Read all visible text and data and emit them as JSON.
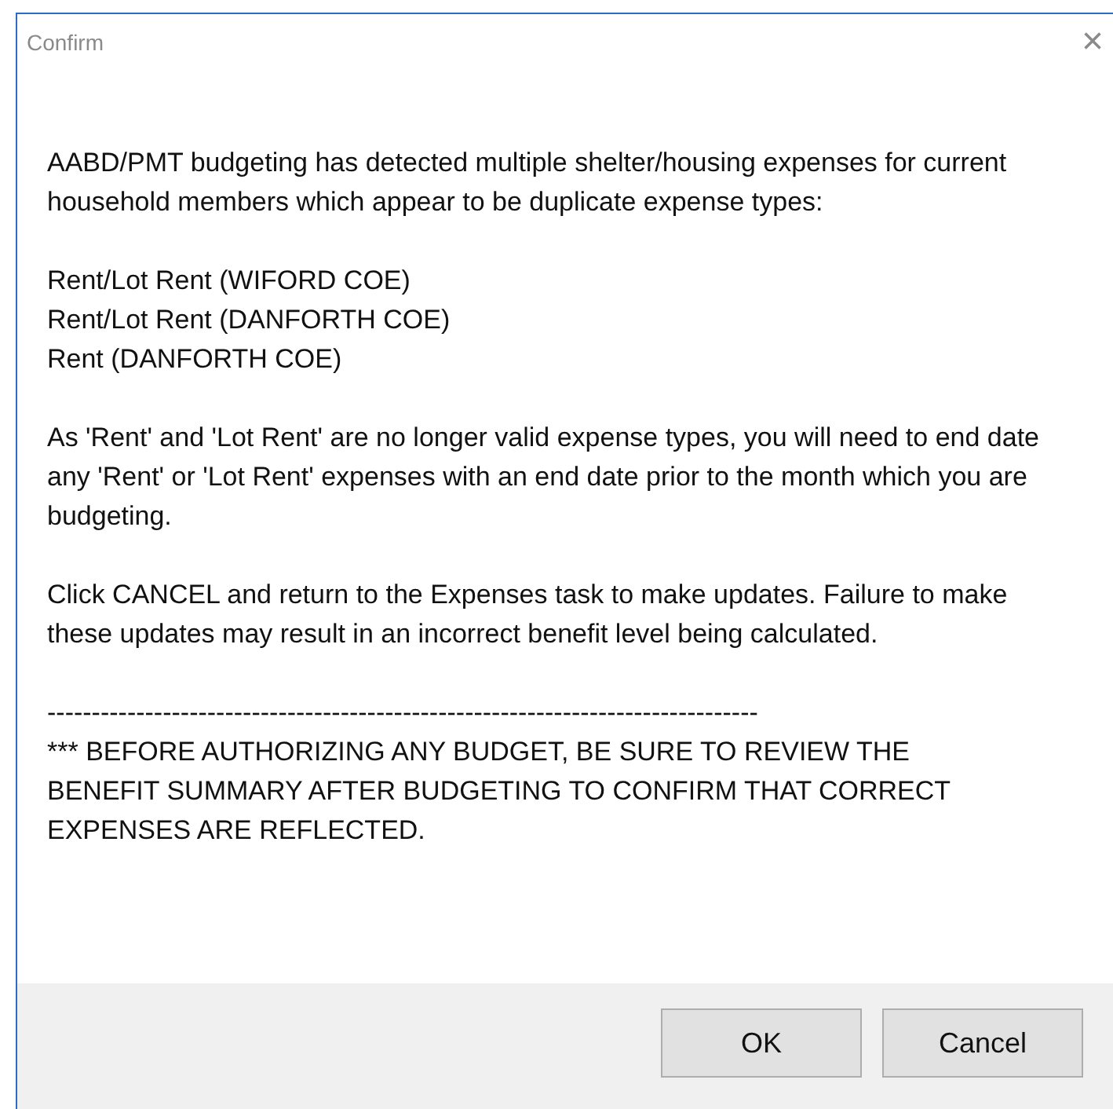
{
  "window": {
    "title": "Confirm",
    "close": "×"
  },
  "message": [
    "AABD/PMT budgeting has detected multiple shelter/housing expenses for current household members which appear to be duplicate expense types:",
    "Rent/Lot Rent (WIFORD COE)\nRent/Lot Rent (DANFORTH COE)\nRent (DANFORTH COE)",
    "As 'Rent' and 'Lot Rent' are no longer valid expense types, you will need to end date any 'Rent' or 'Lot Rent' expenses with an end date prior to the month which you are budgeting.",
    "Click CANCEL and return to the Expenses task to make updates.  Failure to make these updates may result in an incorrect benefit level being calculated."
  ],
  "separator": "--------------------------------------------------------------------------------",
  "warning": "*** BEFORE AUTHORIZING ANY BUDGET, BE SURE TO REVIEW THE BENEFIT SUMMARY AFTER BUDGETING TO CONFIRM THAT CORRECT EXPENSES ARE REFLECTED.",
  "buttons": [
    "OK",
    "Cancel"
  ]
}
